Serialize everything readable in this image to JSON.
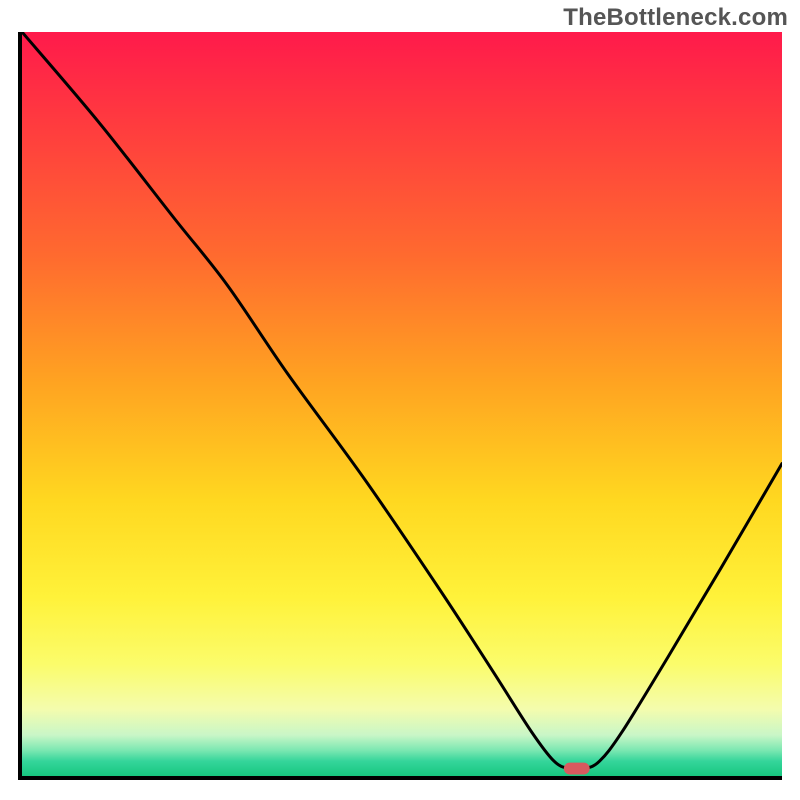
{
  "watermark": "TheBottleneck.com",
  "chart_data": {
    "type": "line",
    "title": "",
    "xlabel": "",
    "ylabel": "",
    "xlim": [
      0,
      100
    ],
    "ylim": [
      0,
      100
    ],
    "grid": false,
    "series": [
      {
        "name": "bottleneck-curve",
        "x": [
          0,
          10,
          20,
          27,
          35,
          45,
          55,
          62,
          67,
          70,
          72,
          74,
          76,
          79,
          85,
          92,
          100
        ],
        "values": [
          100,
          88,
          75,
          66,
          54,
          40,
          25,
          14,
          6,
          2,
          1,
          1,
          2,
          6,
          16,
          28,
          42
        ]
      }
    ],
    "marker": {
      "x": 73,
      "y": 1,
      "color": "#d85a5f"
    },
    "background_gradient": {
      "top": "#ff1a4b",
      "mid": "#ffd820",
      "bottom": "#17c77f"
    }
  }
}
